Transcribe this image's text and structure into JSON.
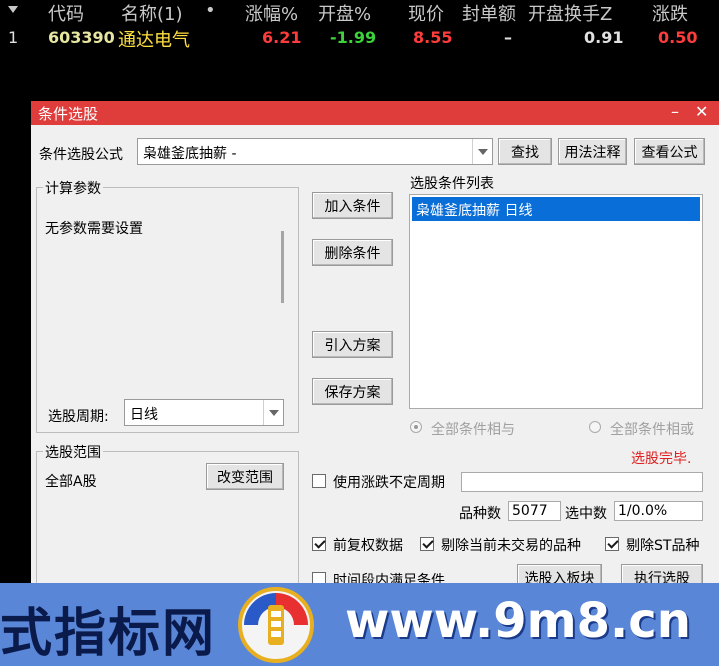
{
  "stock_table": {
    "headers": {
      "code": "代码",
      "name": "名称(1)",
      "dot": "•",
      "change_pct": "涨幅%",
      "open_pct": "开盘%",
      "price": "现价",
      "seal_amount": "封单额",
      "open_turnover": "开盘换手Z",
      "change": "涨跌"
    },
    "row": {
      "index": "1",
      "code": "603390",
      "name": "通达电气",
      "change_pct": "6.21",
      "open_pct": "-1.99",
      "price": "8.55",
      "seal_amount": "–",
      "open_turnover": "0.91",
      "change": "0.50"
    },
    "colors": {
      "up": "#ff3c3c",
      "down": "#3cd23c",
      "code": "#e6e6a0",
      "name": "#ffe040",
      "neutral": "#e0e0e0"
    }
  },
  "dialog": {
    "title": "条件选股",
    "minimize": "–",
    "close": "✕",
    "formula_label": "条件选股公式",
    "formula_value": "枭雄釜底抽薪 -",
    "find_button": "查找",
    "usage_button": "用法注释",
    "view_formula_button": "查看公式",
    "params_group": "计算参数",
    "params_text": "无参数需要设置",
    "period_label": "选股周期:",
    "period_value": "日线",
    "add_condition": "加入条件",
    "delete_condition": "删除条件",
    "import_plan": "引入方案",
    "save_plan": "保存方案",
    "condition_list_label": "选股条件列表",
    "condition_items": [
      "枭雄釜底抽薪  日线"
    ],
    "radio_and": "全部条件相与",
    "radio_or": "全部条件相或",
    "status": "选股完毕.",
    "scope_group": "选股范围",
    "scope_value": "全部A股",
    "change_scope": "改变范围",
    "variable_period": "使用涨跌不定周期",
    "variety_count_label": "品种数",
    "variety_count": "5077",
    "selected_label": "选中数",
    "selected_value": "1/0.0%",
    "forward_adjust": "前复权数据",
    "exclude_untraded": "剔除当前未交易的品种",
    "exclude_st": "剔除ST品种",
    "time_period": "时间段内满足条件",
    "to_block": "选股入板块",
    "execute": "执行选股"
  },
  "banner": {
    "left_text": "式指标网",
    "right_text": "www.9m8.cn",
    "logo_text": "9m8.cn"
  }
}
